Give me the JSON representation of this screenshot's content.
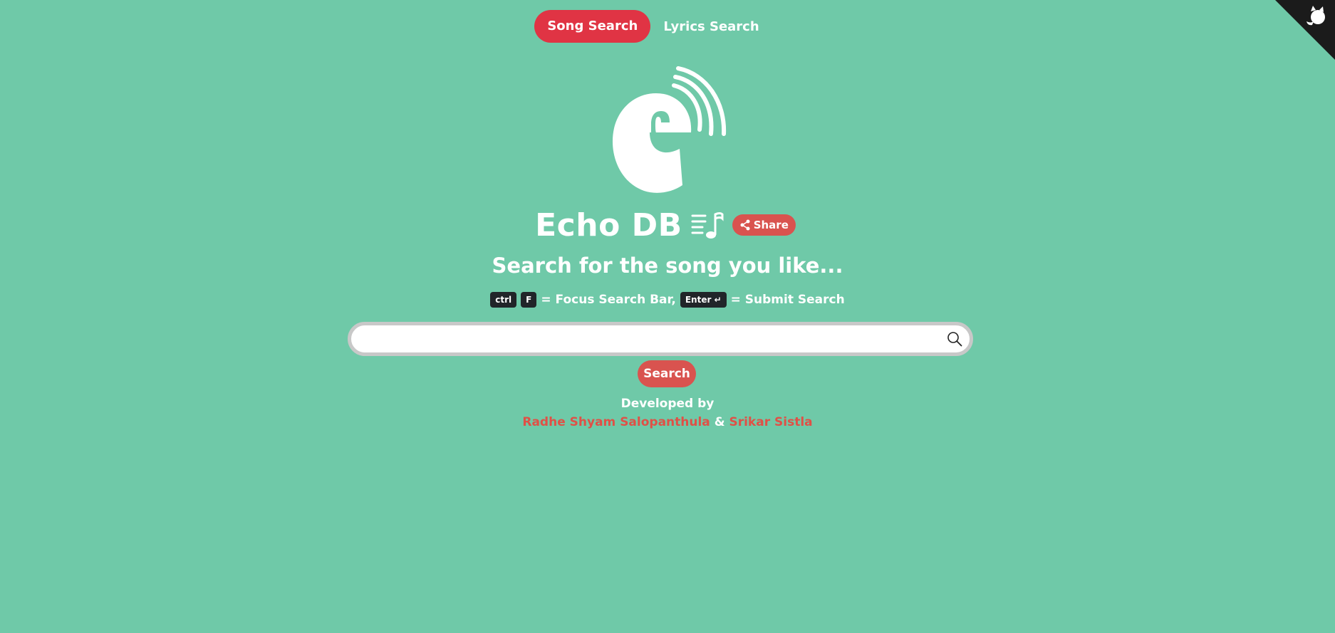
{
  "nav": {
    "song_search": "Song Search",
    "lyrics_search": "Lyrics Search"
  },
  "header": {
    "title": "Echo DB",
    "share_label": "Share"
  },
  "main": {
    "subtitle": "Search for the song you like...",
    "hints": {
      "key_ctrl": "ctrl",
      "key_f": "F",
      "focus_text": "= Focus Search Bar,",
      "key_enter": "Enter ↵",
      "submit_text": "= Submit Search"
    },
    "search": {
      "value": "",
      "placeholder": "",
      "button_label": "Search"
    }
  },
  "footer": {
    "developed_by": "Developed by",
    "developer_1": "Radhe Shyam Salopanthula",
    "separator": "&",
    "developer_2": "Srikar Sistla"
  },
  "colors": {
    "background": "#6fc9a8",
    "accent_red": "#e03444",
    "button_red": "#d9534f",
    "link_red": "#e05046",
    "corner_dark": "#1b1b1b"
  },
  "icons": {
    "corner": "github-corner-icon",
    "logo": "echo-logo",
    "title": "music-note-list-icon",
    "share": "share-icon",
    "search": "search-icon"
  }
}
